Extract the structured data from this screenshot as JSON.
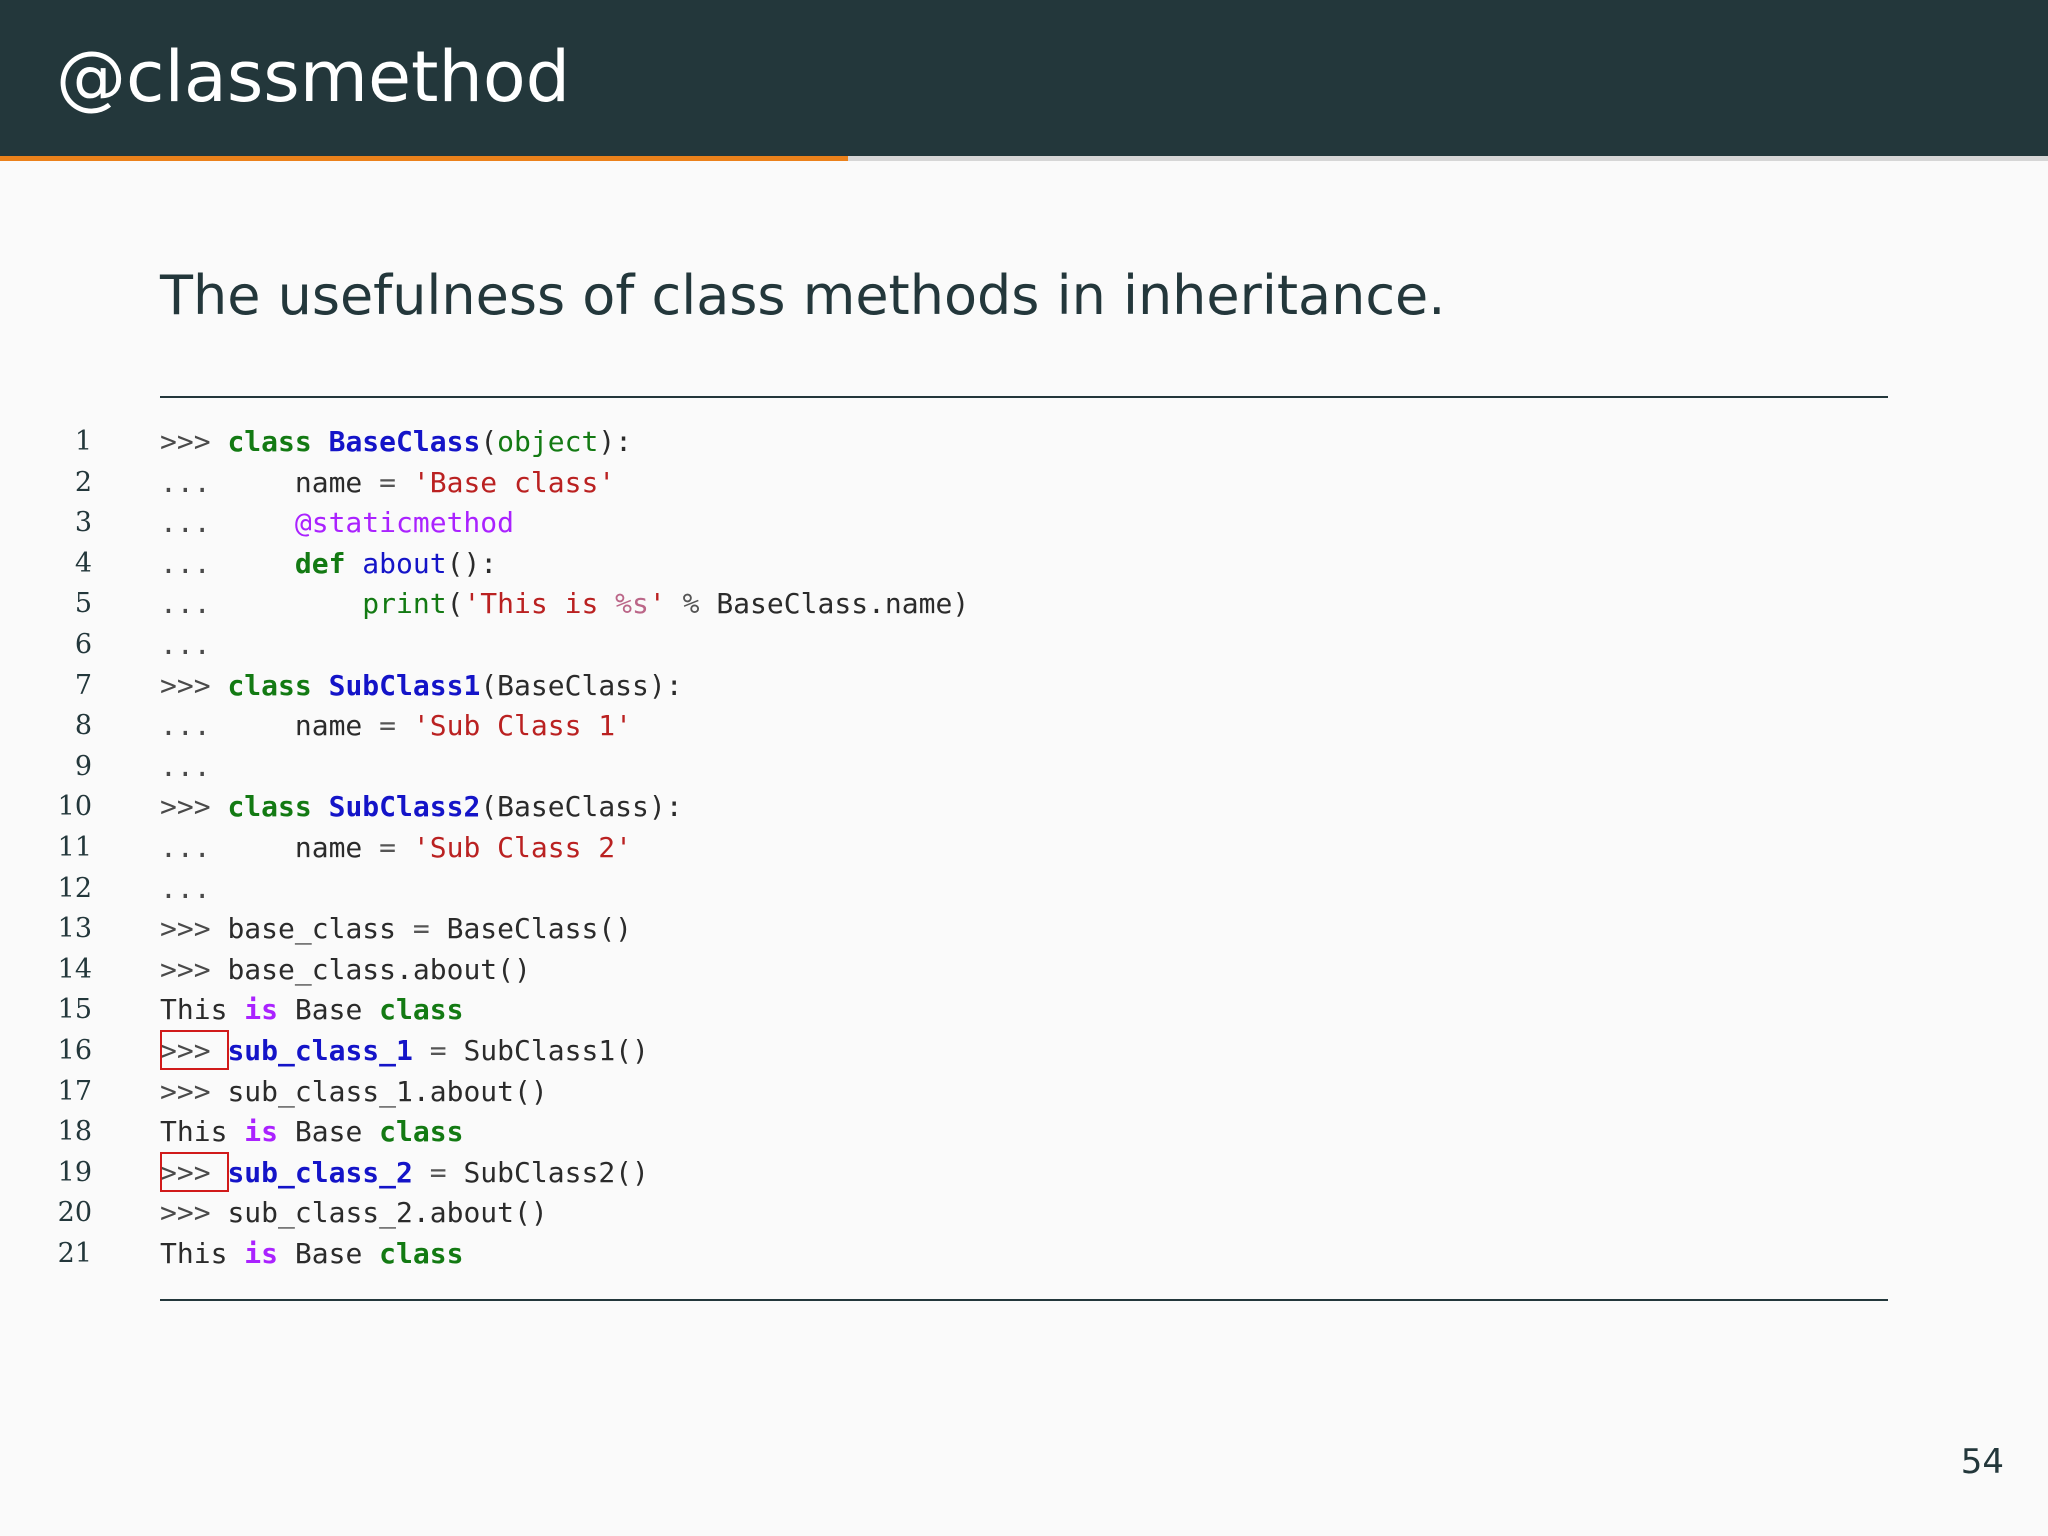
{
  "slide": {
    "title": "@classmethod",
    "subtitle": "The usefulness of class methods in inheritance.",
    "page_number": "54",
    "progress_fraction": 0.414
  },
  "colors": {
    "header_bg": "#23373b",
    "progress_fill": "#eb811b",
    "highlight_box": "#d11a1a",
    "keyword": "#137a13",
    "class_name": "#1414c8",
    "string": "#ba2121",
    "decorator": "#aa22ff"
  },
  "code": {
    "lines": [
      {
        "number": "1",
        "tokens": [
          {
            "t": ">>> ",
            "c": "prompt"
          },
          {
            "t": "class",
            "c": "kw"
          },
          {
            "t": " ",
            "c": "plain"
          },
          {
            "t": "BaseClass",
            "c": "cls"
          },
          {
            "t": "(",
            "c": "plain"
          },
          {
            "t": "object",
            "c": "builtin"
          },
          {
            "t": "):",
            "c": "plain"
          }
        ]
      },
      {
        "number": "2",
        "tokens": [
          {
            "t": "...     ",
            "c": "prompt"
          },
          {
            "t": "name",
            "c": "plain"
          },
          {
            "t": " = ",
            "c": "op"
          },
          {
            "t": "'Base class'",
            "c": "str"
          }
        ]
      },
      {
        "number": "3",
        "tokens": [
          {
            "t": "...     ",
            "c": "prompt"
          },
          {
            "t": "@staticmethod",
            "c": "deco"
          }
        ]
      },
      {
        "number": "4",
        "tokens": [
          {
            "t": "...     ",
            "c": "prompt"
          },
          {
            "t": "def",
            "c": "kw"
          },
          {
            "t": " ",
            "c": "plain"
          },
          {
            "t": "about",
            "c": "fn"
          },
          {
            "t": "():",
            "c": "plain"
          }
        ]
      },
      {
        "number": "5",
        "tokens": [
          {
            "t": "...         ",
            "c": "prompt"
          },
          {
            "t": "print",
            "c": "builtin"
          },
          {
            "t": "(",
            "c": "plain"
          },
          {
            "t": "'This is ",
            "c": "str"
          },
          {
            "t": "%s",
            "c": "interp"
          },
          {
            "t": "'",
            "c": "str"
          },
          {
            "t": " % ",
            "c": "op"
          },
          {
            "t": "BaseClass.name)",
            "c": "plain"
          }
        ]
      },
      {
        "number": "6",
        "tokens": [
          {
            "t": "...",
            "c": "prompt"
          }
        ]
      },
      {
        "number": "7",
        "tokens": [
          {
            "t": ">>> ",
            "c": "prompt"
          },
          {
            "t": "class",
            "c": "kw"
          },
          {
            "t": " ",
            "c": "plain"
          },
          {
            "t": "SubClass1",
            "c": "cls"
          },
          {
            "t": "(BaseClass):",
            "c": "plain"
          }
        ]
      },
      {
        "number": "8",
        "tokens": [
          {
            "t": "...     ",
            "c": "prompt"
          },
          {
            "t": "name",
            "c": "plain"
          },
          {
            "t": " = ",
            "c": "op"
          },
          {
            "t": "'Sub Class 1'",
            "c": "str"
          }
        ]
      },
      {
        "number": "9",
        "tokens": [
          {
            "t": "...",
            "c": "prompt"
          }
        ]
      },
      {
        "number": "10",
        "tokens": [
          {
            "t": ">>> ",
            "c": "prompt"
          },
          {
            "t": "class",
            "c": "kw"
          },
          {
            "t": " ",
            "c": "plain"
          },
          {
            "t": "SubClass2",
            "c": "cls"
          },
          {
            "t": "(BaseClass):",
            "c": "plain"
          }
        ]
      },
      {
        "number": "11",
        "tokens": [
          {
            "t": "...     ",
            "c": "prompt"
          },
          {
            "t": "name",
            "c": "plain"
          },
          {
            "t": " = ",
            "c": "op"
          },
          {
            "t": "'Sub Class 2'",
            "c": "str"
          }
        ]
      },
      {
        "number": "12",
        "tokens": [
          {
            "t": "...",
            "c": "prompt"
          }
        ]
      },
      {
        "number": "13",
        "tokens": [
          {
            "t": ">>> ",
            "c": "prompt"
          },
          {
            "t": "base_class",
            "c": "plain"
          },
          {
            "t": " = ",
            "c": "op"
          },
          {
            "t": "BaseClass()",
            "c": "plain"
          }
        ]
      },
      {
        "number": "14",
        "tokens": [
          {
            "t": ">>> ",
            "c": "prompt"
          },
          {
            "t": "base_class.about()",
            "c": "plain"
          }
        ]
      },
      {
        "number": "15",
        "tokens": [
          {
            "t": "This ",
            "c": "plain"
          },
          {
            "t": "is",
            "c": "is"
          },
          {
            "t": " Base ",
            "c": "plain"
          },
          {
            "t": "class",
            "c": "kw"
          }
        ]
      },
      {
        "number": "16",
        "highlight": true,
        "tokens": [
          {
            "t": ">>> ",
            "c": "prompt"
          },
          {
            "t": "sub_class_1",
            "c": "name-hl"
          },
          {
            "t": " = ",
            "c": "op"
          },
          {
            "t": "SubClass1()",
            "c": "plain"
          }
        ]
      },
      {
        "number": "17",
        "tokens": [
          {
            "t": ">>> ",
            "c": "prompt"
          },
          {
            "t": "sub_class_1.about()",
            "c": "plain"
          }
        ]
      },
      {
        "number": "18",
        "tokens": [
          {
            "t": "This ",
            "c": "plain"
          },
          {
            "t": "is",
            "c": "is"
          },
          {
            "t": " Base ",
            "c": "plain"
          },
          {
            "t": "class",
            "c": "kw"
          }
        ]
      },
      {
        "number": "19",
        "highlight": true,
        "tokens": [
          {
            "t": ">>> ",
            "c": "prompt"
          },
          {
            "t": "sub_class_2",
            "c": "name-hl"
          },
          {
            "t": " = ",
            "c": "op"
          },
          {
            "t": "SubClass2()",
            "c": "plain"
          }
        ]
      },
      {
        "number": "20",
        "tokens": [
          {
            "t": ">>> ",
            "c": "prompt"
          },
          {
            "t": "sub_class_2.about()",
            "c": "plain"
          }
        ]
      },
      {
        "number": "21",
        "tokens": [
          {
            "t": "This ",
            "c": "plain"
          },
          {
            "t": "is",
            "c": "is"
          },
          {
            "t": " Base ",
            "c": "plain"
          },
          {
            "t": "class",
            "c": "kw"
          }
        ]
      }
    ]
  }
}
